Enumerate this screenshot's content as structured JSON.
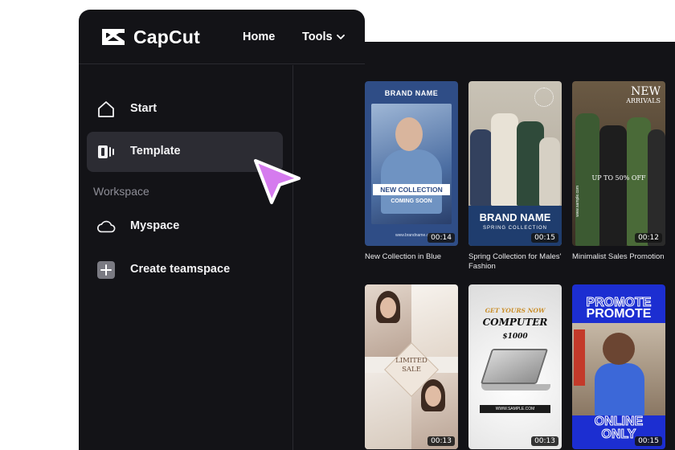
{
  "app": {
    "name": "CapCut"
  },
  "topnav": {
    "home_label": "Home",
    "tools_label": "Tools"
  },
  "sidebar": {
    "items": [
      {
        "label": "Start",
        "icon": "home-icon"
      },
      {
        "label": "Template",
        "icon": "template-icon",
        "active": true
      }
    ],
    "workspace_label": "Workspace",
    "workspace_items": [
      {
        "label": "Myspace",
        "icon": "cloud-icon"
      },
      {
        "label": "Create teamspace",
        "icon": "plus-icon"
      }
    ]
  },
  "templates": [
    {
      "title": "New Collection in Blue",
      "duration": "00:14",
      "art": {
        "top_label": "BRAND NAME",
        "banner": "NEW COLLECTION",
        "sub": "COMING SOON",
        "foot": "www.brandname.com"
      }
    },
    {
      "title": "Spring Collection for Males' Fashion",
      "duration": "00:15",
      "art": {
        "brand": "BRAND NAME",
        "sub": "SPRING COLLECTION"
      }
    },
    {
      "title": "Minimalist Sales Promotion",
      "duration": "00:12",
      "art": {
        "new": "NEW",
        "arrivals": "ARRIVALS",
        "offer": "UP TO 50% OFF",
        "side": "www.sample.com"
      }
    },
    {
      "title": "",
      "duration": "00:13",
      "art": {
        "limited": "LIMITED",
        "sale": "SALE"
      }
    },
    {
      "title": "",
      "duration": "00:13",
      "art": {
        "get": "GET YOURS NOW",
        "computer": "COMPUTER",
        "price": "$1000",
        "url": "WWW.SAMPLE.COM"
      }
    },
    {
      "title": "",
      "duration": "00:15",
      "art": {
        "promote": "PROMOTE",
        "online": "ONLINE",
        "only": "ONLY"
      }
    }
  ],
  "colors": {
    "panel_bg": "#131317",
    "active_item_bg": "#2c2c33",
    "cursor": "#d57bee"
  }
}
